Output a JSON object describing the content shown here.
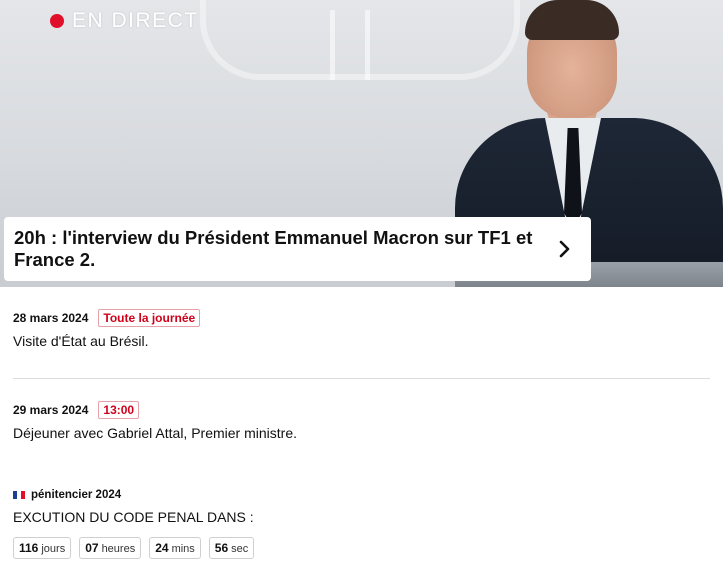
{
  "hero": {
    "live_label": "EN DIRECT",
    "headline": "20h : l'interview du Président Emmanuel Macron sur TF1 et France 2.",
    "live_color": "#e0102a"
  },
  "events": [
    {
      "date": "28 mars 2024",
      "badge": "Toute la journée",
      "description": "Visite d'État au Brésil."
    },
    {
      "date": "29 mars 2024",
      "badge": "13:00",
      "description": "Déjeuner avec Gabriel Attal, Premier ministre."
    }
  ],
  "penitencier": {
    "label": "pénitencier 2024",
    "description": "EXCUTION DU CODE PENAL DANS :",
    "countdown": [
      {
        "value": "116",
        "unit": "jours"
      },
      {
        "value": "07",
        "unit": "heures"
      },
      {
        "value": "24",
        "unit": "mins"
      },
      {
        "value": "56",
        "unit": "sec"
      }
    ]
  },
  "icons": {
    "chevron": "chevron-right-icon",
    "flag": "french-flag-icon"
  }
}
